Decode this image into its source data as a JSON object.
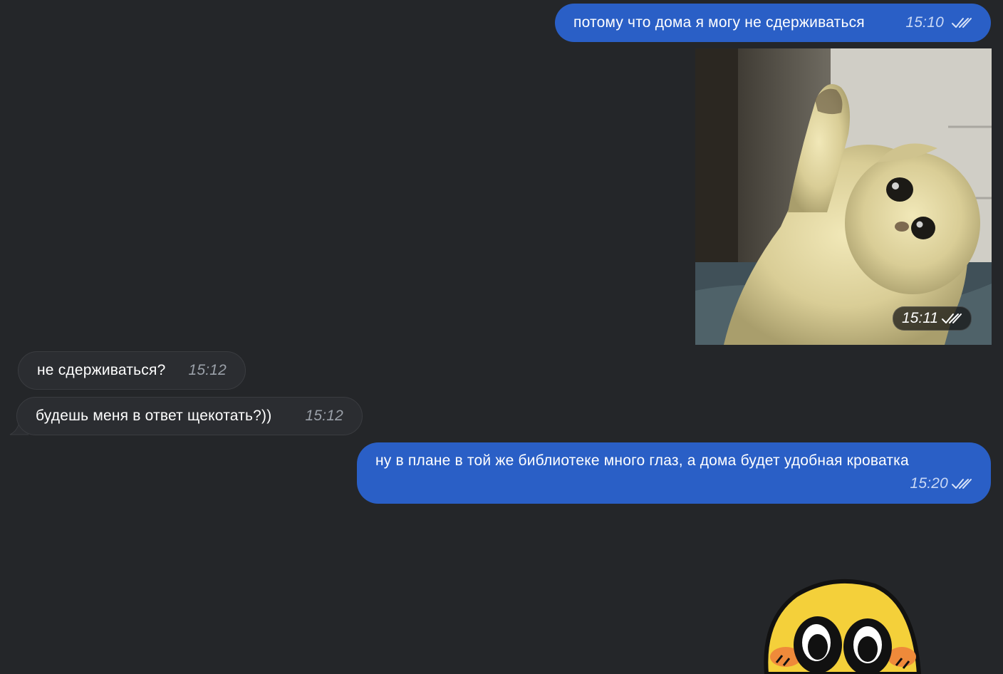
{
  "messages": [
    {
      "text": "потому что дома я могу не сдерживаться",
      "time": "15:10",
      "direction": "out",
      "status": "read"
    },
    {
      "type": "photo",
      "image": "kitten-waving",
      "time": "15:11",
      "direction": "out",
      "status": "read"
    },
    {
      "text": "не сдерживаться?",
      "time": "15:12",
      "direction": "in"
    },
    {
      "text": "будешь меня в ответ щекотать?))",
      "time": "15:12",
      "direction": "in"
    },
    {
      "text": "ну в плане в той же библиотеке много глаз, а дома будет удобная кроватка",
      "time": "15:20",
      "direction": "out",
      "status": "read"
    },
    {
      "type": "sticker",
      "image": "yellow-blushing-face-sticker"
    }
  ],
  "colors": {
    "background": "#242629",
    "outgoing_bubble": "#2a5fc6",
    "incoming_bubble": "#2b2d31"
  },
  "icons": {
    "read_status": "double-check-icon"
  }
}
